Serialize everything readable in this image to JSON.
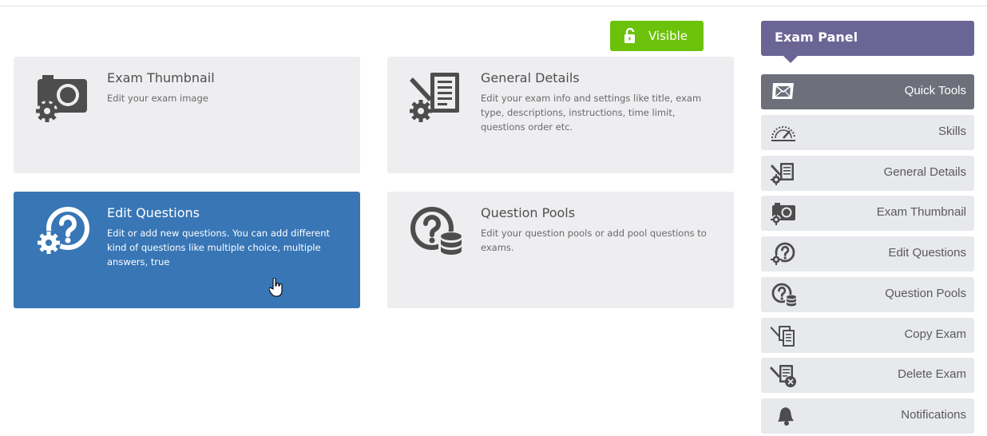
{
  "visibility": {
    "label": "Visible"
  },
  "cards": [
    {
      "title": "Exam Thumbnail",
      "desc": "Edit your exam image"
    },
    {
      "title": "General Details",
      "desc": "Edit your exam info and settings like title, exam type, descriptions, instructions, time limit, questions order etc."
    },
    {
      "title": "Edit Questions",
      "desc": "Edit or add new questions. You can add different kind of questions like multiple choice, multiple answers, true"
    },
    {
      "title": "Question Pools",
      "desc": "Edit your question pools or add pool questions to exams."
    }
  ],
  "panel": {
    "title": "Exam Panel",
    "items": [
      {
        "label": "Quick Tools",
        "icon": "quick-tools-icon"
      },
      {
        "label": "Skills",
        "icon": "gauge-icon"
      },
      {
        "label": "General Details",
        "icon": "document-gear-icon"
      },
      {
        "label": "Exam Thumbnail",
        "icon": "camera-gear-icon"
      },
      {
        "label": "Edit Questions",
        "icon": "question-gear-icon"
      },
      {
        "label": "Question Pools",
        "icon": "question-database-icon"
      },
      {
        "label": "Copy Exam",
        "icon": "copy-document-icon"
      },
      {
        "label": "Delete Exam",
        "icon": "delete-document-icon"
      },
      {
        "label": "Notifications",
        "icon": "bell-icon"
      }
    ]
  },
  "colors": {
    "accent_green": "#6cc20a",
    "card_active": "#3876b6",
    "panel_header": "#6b6596",
    "menu_active": "#6d6f7a"
  }
}
